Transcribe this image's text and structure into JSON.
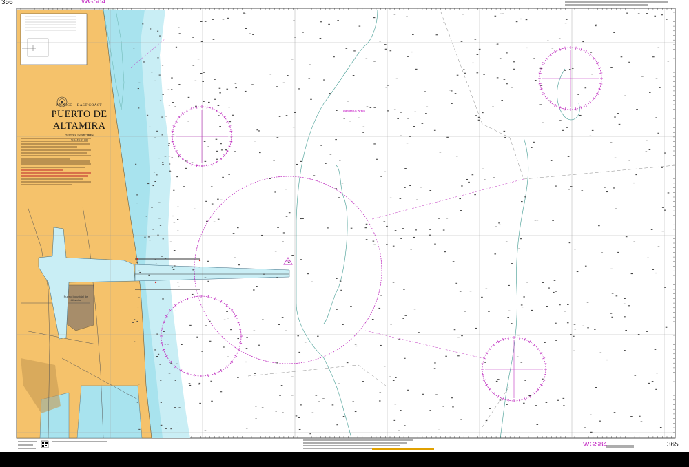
{
  "chart": {
    "number_top_left": "356",
    "number_bottom_right": "365",
    "datum_top": "WGS84",
    "datum_bottom": "WGS84",
    "title_subtitle": "MEXICO – EAST COAST",
    "title_main": "PUERTO DE ALTAMIRA",
    "title_depths": "DEPTHS IN METRES",
    "title_scale": "SCALE 1:25 000",
    "dangerous_sign_label": "Dangerous Wreck",
    "industrial_port_label": "Puerto Industrial de Altamira"
  },
  "colors": {
    "land": "#f5c26b",
    "land_dark": "#a78d6a",
    "shallow_water": "#a8e3ee",
    "mid_water": "#c9eef5",
    "deep_water": "#ffffff",
    "magenta": "#c030c0",
    "contour": "#5aa8a0",
    "grid": "#9a9a9a",
    "sounding": "#333333"
  },
  "icons": [
    "compass-rose-icon",
    "warning-triangle-icon",
    "crest-icon",
    "qr-code-icon"
  ]
}
